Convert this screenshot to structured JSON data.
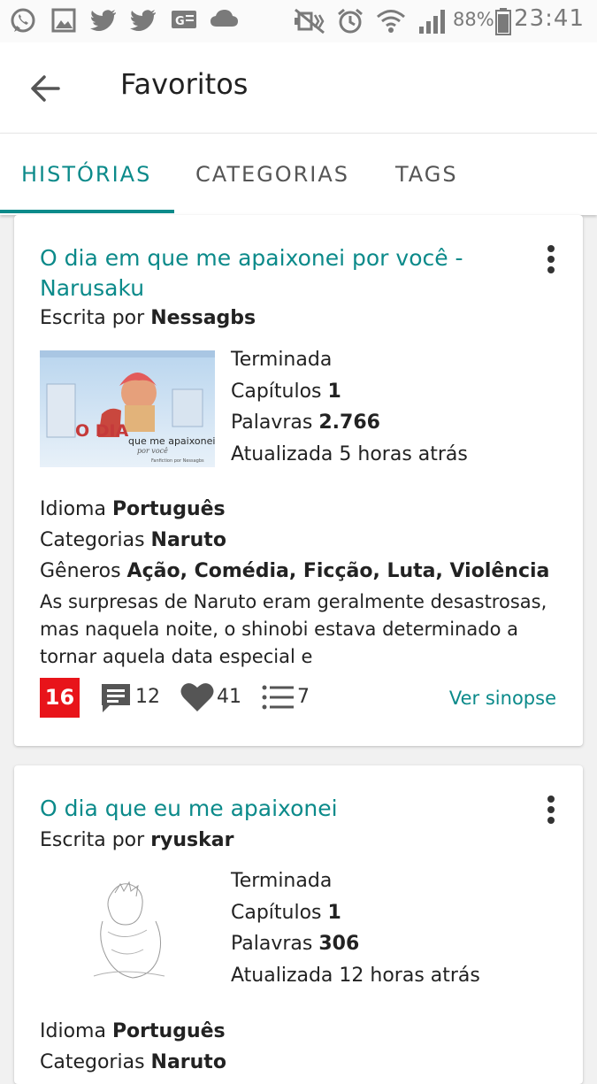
{
  "status_bar": {
    "battery": "88%",
    "time": "23:41",
    "icons": [
      "whatsapp-icon",
      "gallery-icon",
      "twitter-icon",
      "twitter-icon",
      "news-icon",
      "cloud-icon",
      "mute-icon",
      "alarm-icon",
      "wifi-icon",
      "signal-icon",
      "battery-icon"
    ]
  },
  "appbar": {
    "title": "Favoritos",
    "back_icon": "arrow-back-icon"
  },
  "tabs": [
    {
      "label": "HISTÓRIAS",
      "active": true
    },
    {
      "label": "CATEGORIAS",
      "active": false
    },
    {
      "label": "TAGS",
      "active": false
    }
  ],
  "colors": {
    "accent": "#0b8a8a",
    "rating_red": "#e8141a"
  },
  "stories": [
    {
      "title": "O dia em que me apaixonei por você - Narusaku",
      "author_prefix": "Escrita por",
      "author": "Nessagbs",
      "cover_text": {
        "line1": "O DIA",
        "line2": "que me apaixonei",
        "line3": "por você",
        "credit": "Fanfiction por Nessagbs"
      },
      "status": "Terminada",
      "chapters_label": "Capítulos",
      "chapters": "1",
      "words_label": "Palavras",
      "words": "2.766",
      "updated": "Atualizada 5 horas atrás",
      "language_label": "Idioma",
      "language": "Português",
      "categories_label": "Categorias",
      "categories": "Naruto",
      "genres_label": "Gêneros",
      "genres": "Ação, Comédia, Ficção, Luta, Violência",
      "synopsis": "As surpresas de Naruto eram geralmente desastrosas, mas naquela noite, o shinobi estava determinado a tornar aquela data especial e",
      "rating": "16",
      "comments": "12",
      "favorites": "41",
      "lists": "7",
      "ver_sinopse": "Ver sinopse"
    },
    {
      "title": "O dia que eu me apaixonei",
      "author_prefix": "Escrita por",
      "author": "ryuskar",
      "status": "Terminada",
      "chapters_label": "Capítulos",
      "chapters": "1",
      "words_label": "Palavras",
      "words": "306",
      "updated": "Atualizada 12 horas atrás",
      "language_label": "Idioma",
      "language": "Português",
      "categories_label": "Categorias",
      "categories": "Naruto"
    }
  ]
}
